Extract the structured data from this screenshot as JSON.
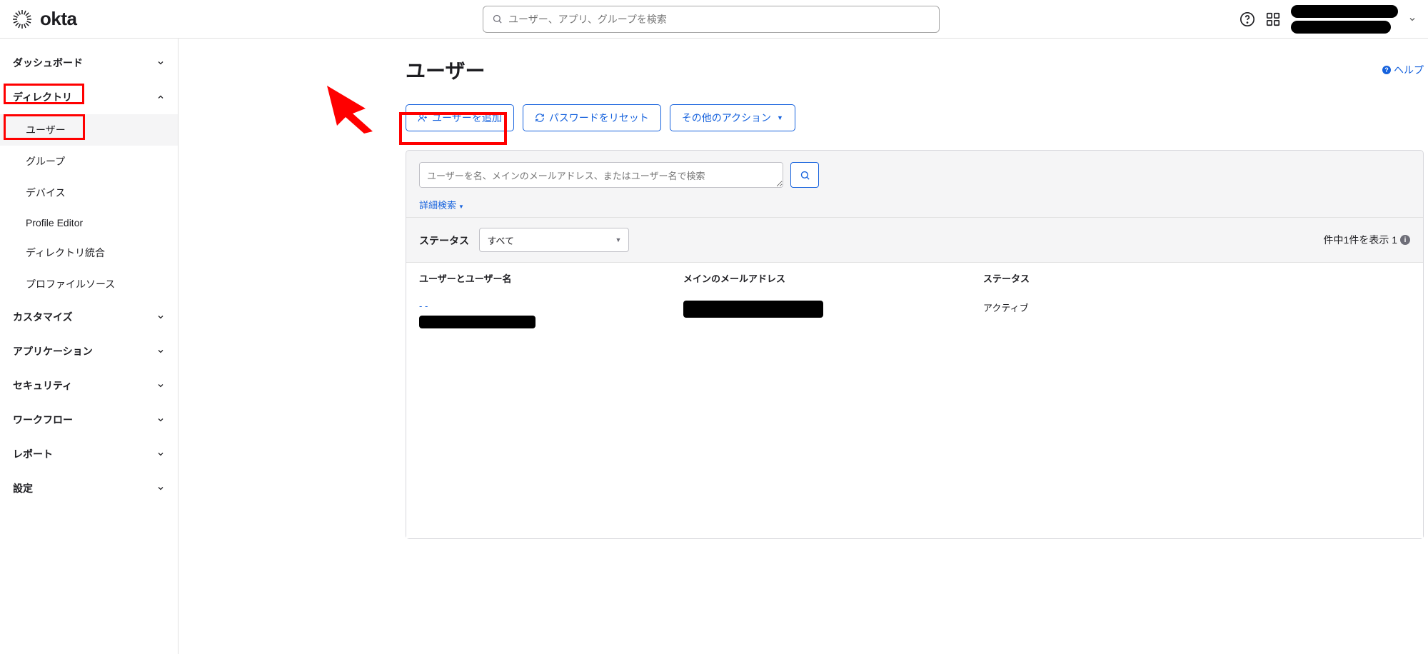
{
  "brand": "okta",
  "header": {
    "search_placeholder": "ユーザー、アプリ、グループを検索"
  },
  "sidebar": {
    "items": [
      {
        "label": "ダッシュボード",
        "expanded": false
      },
      {
        "label": "ディレクトリ",
        "expanded": true,
        "children": [
          {
            "label": "ユーザー",
            "active": true
          },
          {
            "label": "グループ"
          },
          {
            "label": "デバイス"
          },
          {
            "label": "Profile Editor"
          },
          {
            "label": "ディレクトリ統合"
          },
          {
            "label": "プロファイルソース"
          }
        ]
      },
      {
        "label": "カスタマイズ",
        "expanded": false
      },
      {
        "label": "アプリケーション",
        "expanded": false
      },
      {
        "label": "セキュリティ",
        "expanded": false
      },
      {
        "label": "ワークフロー",
        "expanded": false
      },
      {
        "label": "レポート",
        "expanded": false
      },
      {
        "label": "設定",
        "expanded": false
      }
    ]
  },
  "page": {
    "title": "ユーザー",
    "help": "ヘルプ",
    "actions": {
      "add_user": "ユーザーを追加",
      "reset_password": "パスワードをリセット",
      "other": "その他のアクション"
    },
    "panel": {
      "search_placeholder": "ユーザーを名、メインのメールアドレス、またはユーザー名で検索",
      "advanced_search": "詳細検索",
      "status_label": "ステータス",
      "status_value": "すべて",
      "showing_text": "件中1件を表示 1"
    },
    "table": {
      "col_user": "ユーザーとユーザー名",
      "col_email": "メインのメールアドレス",
      "col_status": "ステータス",
      "rows": [
        {
          "user_link": "- -",
          "status": "アクティブ"
        }
      ]
    }
  },
  "colors": {
    "primary": "#1662dd",
    "border": "#d7d7dc",
    "panel_bg": "#f5f5f6"
  }
}
